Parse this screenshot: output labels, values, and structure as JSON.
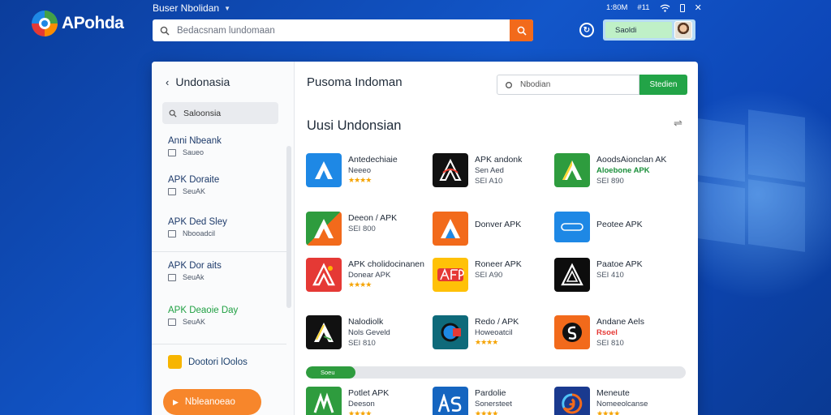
{
  "app": {
    "name": "APohda",
    "top_title": "Buser Nbolidan"
  },
  "search": {
    "placeholder": "Bedacsnam lundomaan"
  },
  "status_bar": {
    "time": "1:80M",
    "signal": "#11"
  },
  "account": {
    "label": "Saoldi"
  },
  "sidebar": {
    "heading": "Undonasia",
    "search_placeholder": "Saloonsia",
    "items": [
      {
        "title": "Anni Nbeank",
        "sub": "Saueo"
      },
      {
        "title": "APK Doraite",
        "sub": "SeuAK"
      },
      {
        "title": "APK Ded Sley",
        "sub": "Nbooadcil"
      },
      {
        "title": "APK Dor aits",
        "sub": "SeuAk"
      },
      {
        "title": "APK Deaoie Day",
        "sub": "SeuAK"
      }
    ],
    "extra_item": "Dootori lOolos",
    "cta_label": "Nbleanoeao"
  },
  "content": {
    "title": "Pusoma Indoman",
    "search_placeholder": "Nbodian",
    "search_button": "Stedien",
    "subtitle": "Uusi Undonsian",
    "apps": [
      {
        "name": "Antedechiaie",
        "sub": "Neeeo",
        "rating": "★★★★",
        "price": ""
      },
      {
        "name": "APK andonk",
        "sub": "Sen Aed",
        "rating": "",
        "price": "SEI A10"
      },
      {
        "name": "AoodsAionclan AK",
        "sub": "Aloebone APK",
        "sub_green": true,
        "rating": "",
        "price": "SEI 890"
      },
      {
        "name": "Deeon / APK",
        "sub": "",
        "rating": "",
        "price": "SEI 800"
      },
      {
        "name": "Donver APK",
        "sub": "",
        "rating": "",
        "price": ""
      },
      {
        "name": "Peotee APK",
        "sub": "",
        "rating": "",
        "price": ""
      },
      {
        "name": "APK cholidocinanen",
        "sub": "Donear APK",
        "rating": "★★★★",
        "price": ""
      },
      {
        "name": "Roneer APK",
        "sub": "",
        "rating": "",
        "price": "SEI A90"
      },
      {
        "name": "Paatoe APK",
        "sub": "",
        "rating": "",
        "price": "SEI 410"
      },
      {
        "name": "Nalodiolk",
        "sub": "Nols Geveld",
        "rating": "",
        "price": "SEI 810"
      },
      {
        "name": "Redo / APK",
        "sub": "Howeoatcil",
        "rating": "★★★★",
        "price": ""
      },
      {
        "name": "Andane Aels",
        "sub": "Rsoel",
        "rating": "",
        "price": "SEI 810"
      },
      {
        "name": "Potlet APK",
        "sub": "Deeson",
        "rating": "★★★★",
        "price": ""
      },
      {
        "name": "Pardolie",
        "sub": "Sonersteet",
        "rating": "★★★★",
        "price": ""
      },
      {
        "name": "Meneute",
        "sub": "Nomeeolcanse",
        "rating": "★★★★",
        "price": ""
      }
    ],
    "progress_label": "Soeu",
    "progress_fraction": 0.13
  },
  "colors": {
    "accent_orange": "#f26a1b",
    "accent_green": "#22a447",
    "background_blue": "#1256c9"
  }
}
